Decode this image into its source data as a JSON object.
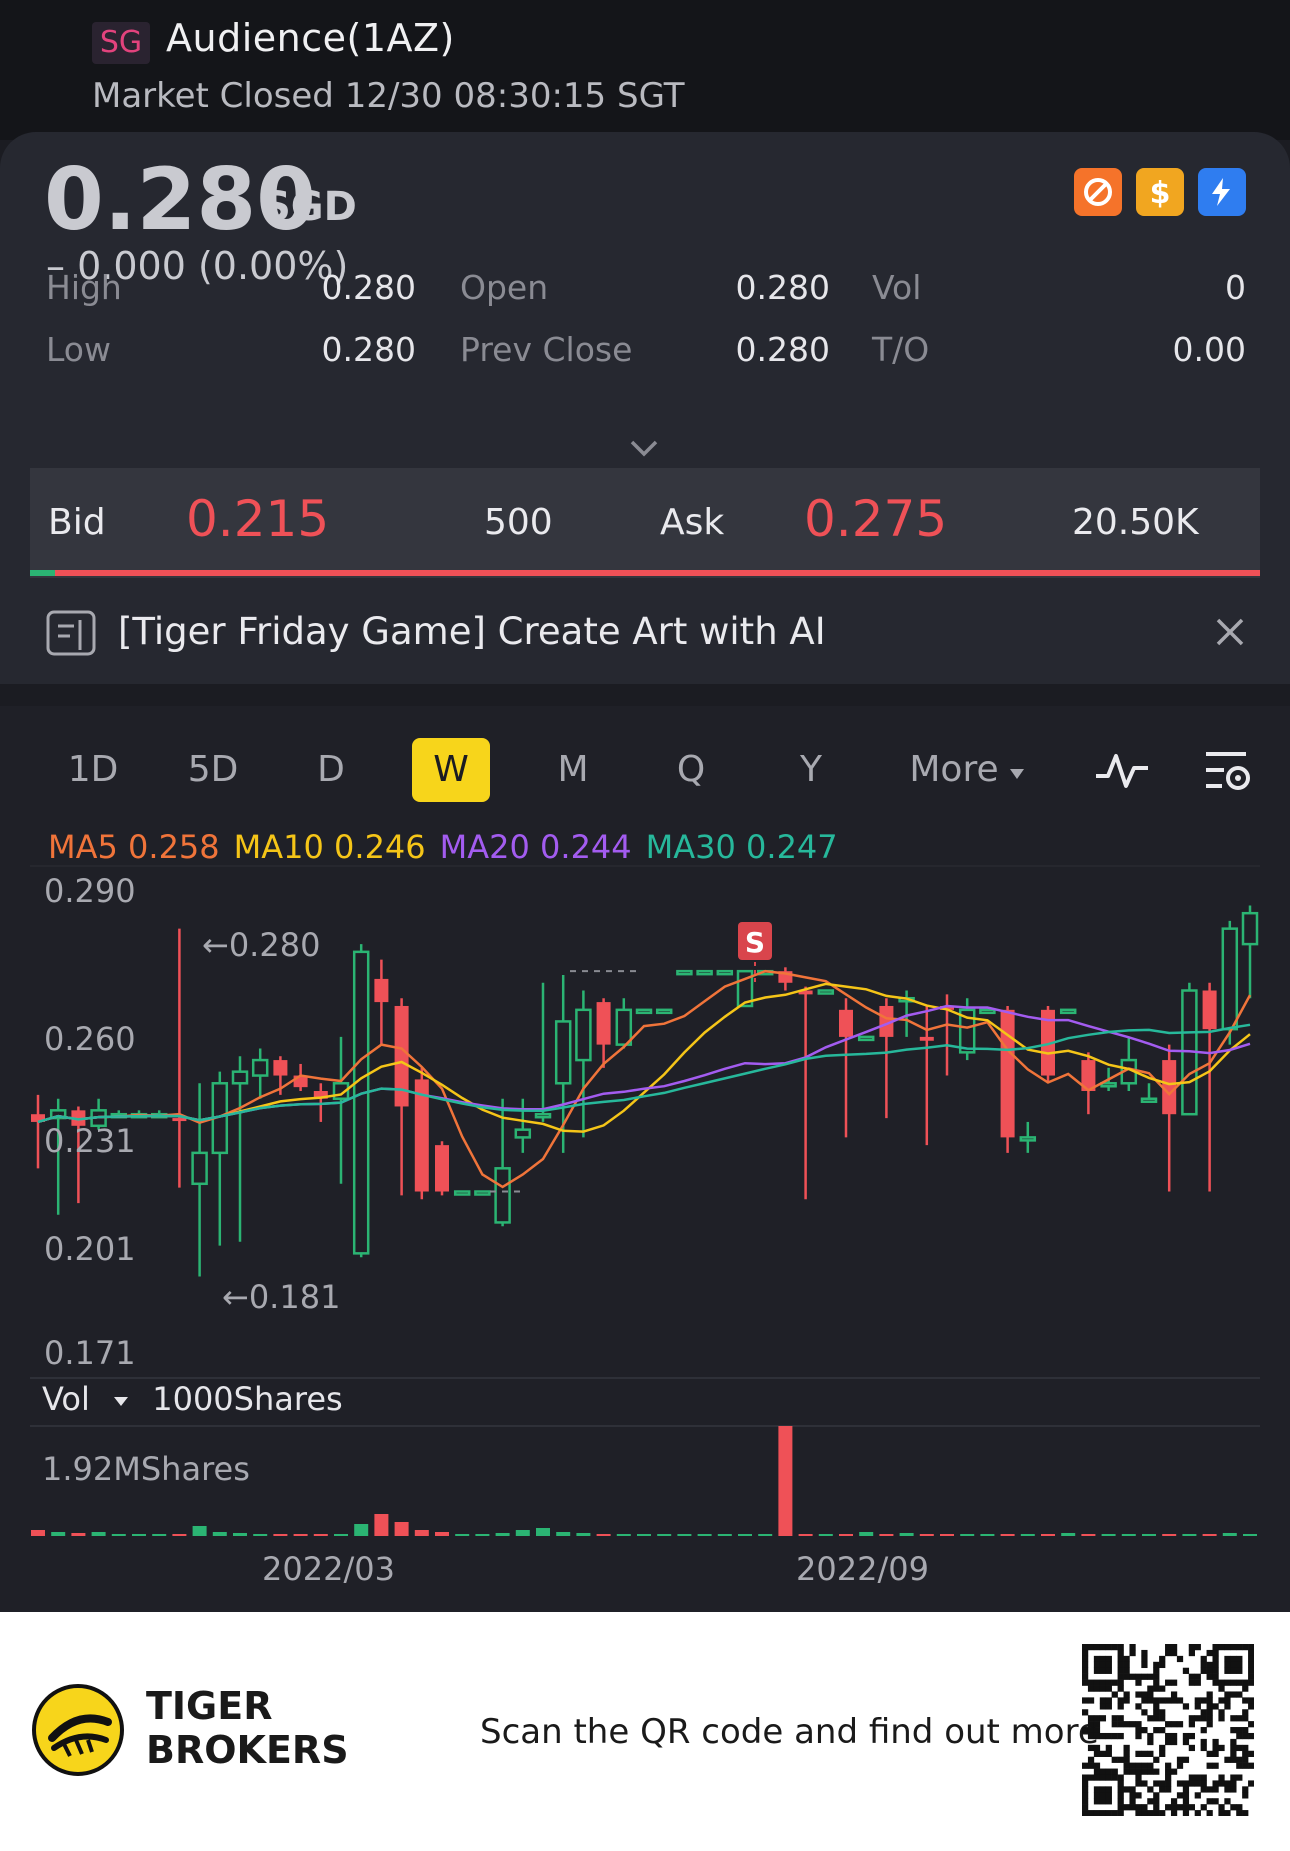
{
  "header": {
    "market_badge": "SG",
    "stock_name": "Audience(1AZ)",
    "market_status": "Market Closed 12/30 08:30:15 SGT"
  },
  "quote": {
    "price": "0.280",
    "currency": "SGD",
    "change": "– 0.000 (0.00%)",
    "badges": [
      "no-short-icon",
      "dollar-icon",
      "flash-icon"
    ],
    "stats": [
      {
        "label": "High",
        "value": "0.280"
      },
      {
        "label": "Open",
        "value": "0.280"
      },
      {
        "label": "Vol",
        "value": "0"
      },
      {
        "label": "Low",
        "value": "0.280"
      },
      {
        "label": "Prev Close",
        "value": "0.280"
      },
      {
        "label": "T/O",
        "value": "0.00"
      }
    ]
  },
  "bidask": {
    "bid_label": "Bid",
    "bid_price": "0.215",
    "bid_qty": "500",
    "ask_label": "Ask",
    "ask_price": "0.275",
    "ask_qty": "20.50K",
    "bid_ratio": 0.02
  },
  "promo": {
    "text": "[Tiger Friday Game] Create Art with AI"
  },
  "periods": [
    "1D",
    "5D",
    "D",
    "W",
    "M",
    "Q",
    "Y",
    "More"
  ],
  "active_period": "W",
  "ma": [
    {
      "label": "MA5 0.258",
      "color": "#f0743a"
    },
    {
      "label": "MA10 0.246",
      "color": "#f5c518"
    },
    {
      "label": "MA20 0.244",
      "color": "#a35cf0"
    },
    {
      "label": "MA30 0.247",
      "color": "#27b89b"
    }
  ],
  "colors": {
    "up": "#2bb473",
    "down": "#ef5157",
    "accent": "#f7d51b"
  },
  "chart_data": {
    "type": "candlestick",
    "y_ticks": [
      "0.290",
      "0.260",
      "0.231",
      "0.201",
      "0.171"
    ],
    "ylim": [
      0.171,
      0.29
    ],
    "high_marker": "←0.280",
    "low_marker": "←0.181",
    "signal_label": "S",
    "x_labels": [
      "2022/03",
      "2022/09"
    ],
    "volume_label": "Vol",
    "volume_unit": "1000Shares",
    "volume_max": "1.92MShares"
  },
  "footer": {
    "brand_line1": "TIGER",
    "brand_line2": "BROKERS",
    "tagline": "Scan the QR code and find out more"
  }
}
